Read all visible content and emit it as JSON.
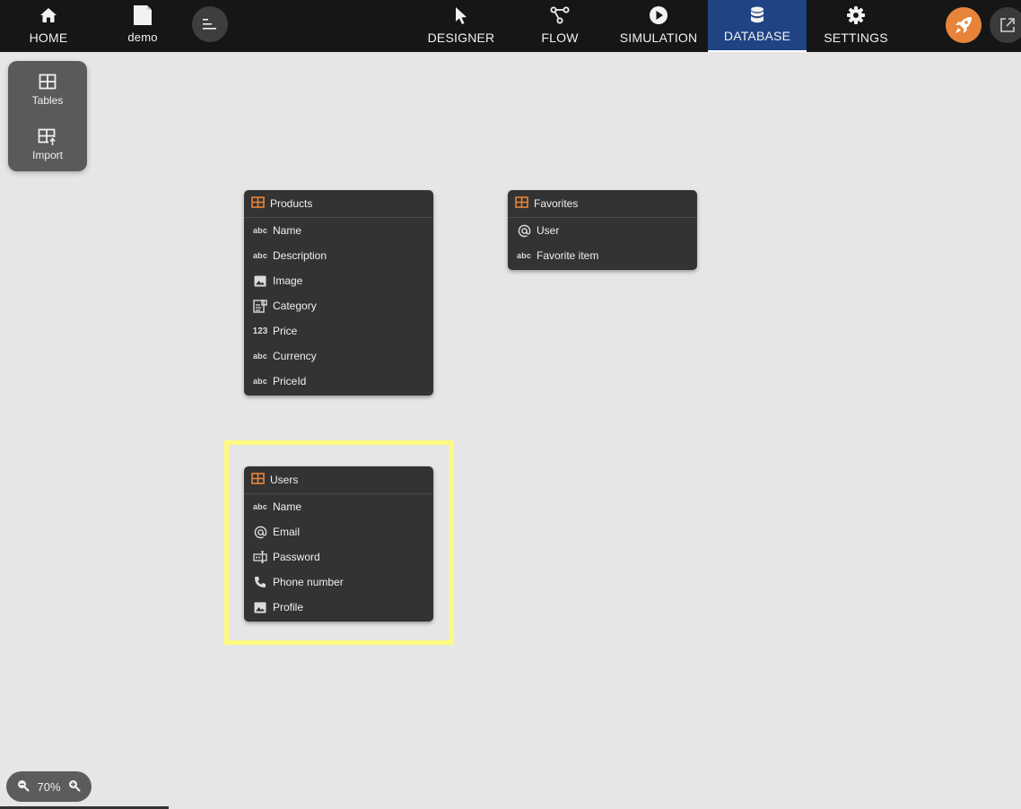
{
  "topbar": {
    "home": {
      "label": "HOME",
      "icon": "home-icon"
    },
    "project": {
      "label": "demo",
      "icon": "document-icon"
    },
    "tabs": [
      {
        "label": "DESIGNER",
        "icon": "cursor-icon"
      },
      {
        "label": "FLOW",
        "icon": "flow-icon"
      },
      {
        "label": "SIMULATION",
        "icon": "play-icon"
      },
      {
        "label": "DATABASE",
        "icon": "database-icon",
        "active": true
      },
      {
        "label": "SETTINGS",
        "icon": "gear-icon"
      }
    ],
    "accent_color": "#1f4383",
    "rocket_color": "#e8843a"
  },
  "side_panel": {
    "tables_label": "Tables",
    "import_label": "Import"
  },
  "tables": {
    "products": {
      "title": "Products",
      "fields": [
        {
          "name": "Name",
          "type": "text"
        },
        {
          "name": "Description",
          "type": "text"
        },
        {
          "name": "Image",
          "type": "image"
        },
        {
          "name": "Category",
          "type": "category"
        },
        {
          "name": "Price",
          "type": "number"
        },
        {
          "name": "Currency",
          "type": "text"
        },
        {
          "name": "PriceId",
          "type": "text"
        }
      ]
    },
    "favorites": {
      "title": "Favorites",
      "fields": [
        {
          "name": "User",
          "type": "email"
        },
        {
          "name": "Favorite item",
          "type": "text"
        }
      ]
    },
    "users": {
      "title": "Users",
      "fields": [
        {
          "name": "Name",
          "type": "text"
        },
        {
          "name": "Email",
          "type": "email"
        },
        {
          "name": "Password",
          "type": "password"
        },
        {
          "name": "Phone number",
          "type": "phone"
        },
        {
          "name": "Profile",
          "type": "image"
        }
      ]
    }
  },
  "icon_text": {
    "abc": "abc",
    "num": "123"
  },
  "zoom": {
    "level": "70%"
  },
  "highlight_color": "#fdfb7e"
}
